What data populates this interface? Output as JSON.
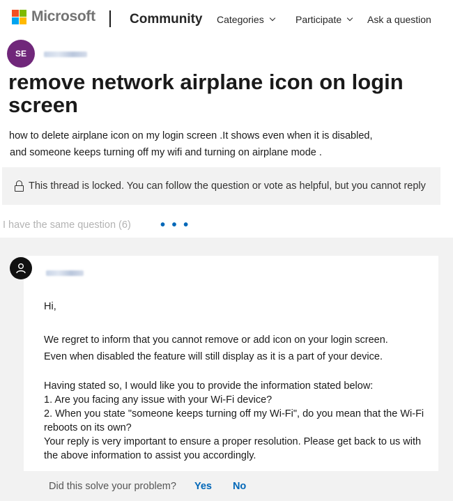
{
  "header": {
    "brand": "Microsoft",
    "logo_colors": [
      "#f25022",
      "#7fba00",
      "#00a4ef",
      "#ffb900"
    ],
    "site": "Community",
    "nav": [
      {
        "label": "Categories"
      },
      {
        "label": "Participate"
      },
      {
        "label": "Ask a question"
      }
    ]
  },
  "question": {
    "author_initials": "SE",
    "title": "remove network airplane icon on login screen",
    "body_lines": [
      "how to delete airplane icon on my login screen .It shows even when it is disabled,",
      "and someone keeps turning off my wifi and turning on airplane mode ."
    ],
    "locked_message": "This thread is locked. You can follow the question or vote as helpful, but you cannot reply",
    "same_question": "I have the same question (6)",
    "more": "• • •"
  },
  "reply": {
    "greeting": "Hi,",
    "p1_lines": [
      "We regret to inform that you cannot remove or add icon on your login screen.",
      "Even when disabled the feature will still display as it is a part of your device."
    ],
    "p2_lines": [
      "Having stated so, I would like you to provide the information stated below:",
      "1. Are you facing any issue with your Wi-Fi device?",
      "2. When you state \"someone keeps turning off my Wi-Fi\", do you mean that the Wi-Fi reboots on its own?",
      "Your reply is very important to ensure a proper resolution. Please get back to us with the above information to assist you accordingly."
    ],
    "feedback_prompt": "Did this solve your problem?",
    "yes": "Yes",
    "no": "No"
  },
  "colors": {
    "accent": "#0067b8",
    "avatar_se": "#70277a",
    "panel_bg": "#f2f2f2"
  }
}
